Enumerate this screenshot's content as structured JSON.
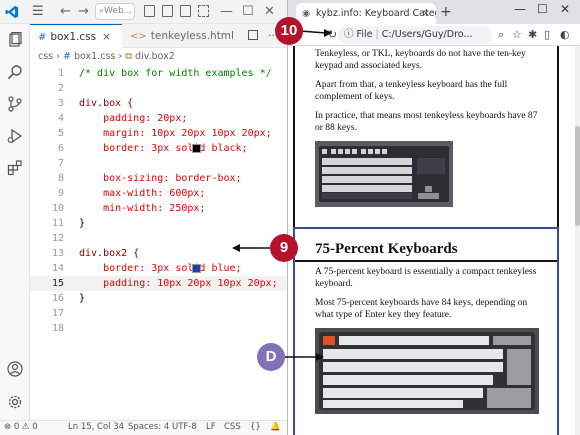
{
  "vscode": {
    "search_placeholder": "Web...",
    "tabs": [
      {
        "icon": "#",
        "label": "box1.css",
        "close": "×"
      },
      {
        "icon": "<>",
        "label": "tenkeyless.html"
      }
    ],
    "more": "···",
    "breadcrumbs": [
      "css",
      "#",
      "box1.css",
      "div.box2"
    ],
    "lines": [
      {
        "n": "1",
        "text": "/* div box for width examples */"
      },
      {
        "n": "2",
        "text": ""
      },
      {
        "n": "3",
        "text": "div.box {"
      },
      {
        "n": "4",
        "text": "    padding: 20px;"
      },
      {
        "n": "5",
        "text": "    margin: 10px 20px 10px 20px;"
      },
      {
        "n": "6",
        "text": "    border: 3px solid black;"
      },
      {
        "n": "7",
        "text": ""
      },
      {
        "n": "8",
        "text": "    box-sizing: border-box;"
      },
      {
        "n": "9",
        "text": "    max-width: 600px;"
      },
      {
        "n": "10",
        "text": "    min-width: 250px;"
      },
      {
        "n": "11",
        "text": "}"
      },
      {
        "n": "12",
        "text": ""
      },
      {
        "n": "13",
        "text": "div.box2 {"
      },
      {
        "n": "14",
        "text": "    border: 3px solid blue;"
      },
      {
        "n": "15",
        "text": "    padding: 10px 20px 10px 20px;"
      },
      {
        "n": "16",
        "text": "}"
      },
      {
        "n": "17",
        "text": ""
      },
      {
        "n": "18",
        "text": ""
      }
    ],
    "swatch_colors": {
      "black": "#000000",
      "blue": "#1f3fae"
    },
    "status": {
      "problems": "⊗ 0 ⚠ 0",
      "position": "Ln 15, Col 34",
      "spaces": "Spaces: 4",
      "encoding": "UTF-8",
      "eol": "LF",
      "language": "CSS"
    }
  },
  "browser": {
    "tab_title": "kybz.info: Keyboard Categories",
    "tab_close": "×",
    "new_tab": "+",
    "url_prefix": "File",
    "url": "C:/Users/Guy/Dro...",
    "box1_paragraphs": [
      "Tenkeyless, or TKL, keyboards do not have the ten-key keypad and associated keys.",
      "Apart from that, a tenkeyless keyboard has the full complement of keys.",
      "In practice, that means most tenkeyless keyboards have 87 or 88 keys."
    ],
    "box2_heading": "75-Percent Keyboards",
    "box2_paragraphs": [
      "A 75-percent keyboard is essentially a compact tenkeyless keyboard.",
      "Most 75-percent keyboards have 84 keys, depending on what type of Enter key they feature."
    ]
  },
  "callouts": {
    "step10": "10",
    "step9": "9",
    "stepD": "D"
  },
  "colors": {
    "accent": "#005fb8",
    "callout_red": "#b5122d",
    "callout_purple": "#8270b8",
    "box2_border": "#3a4a9a"
  }
}
